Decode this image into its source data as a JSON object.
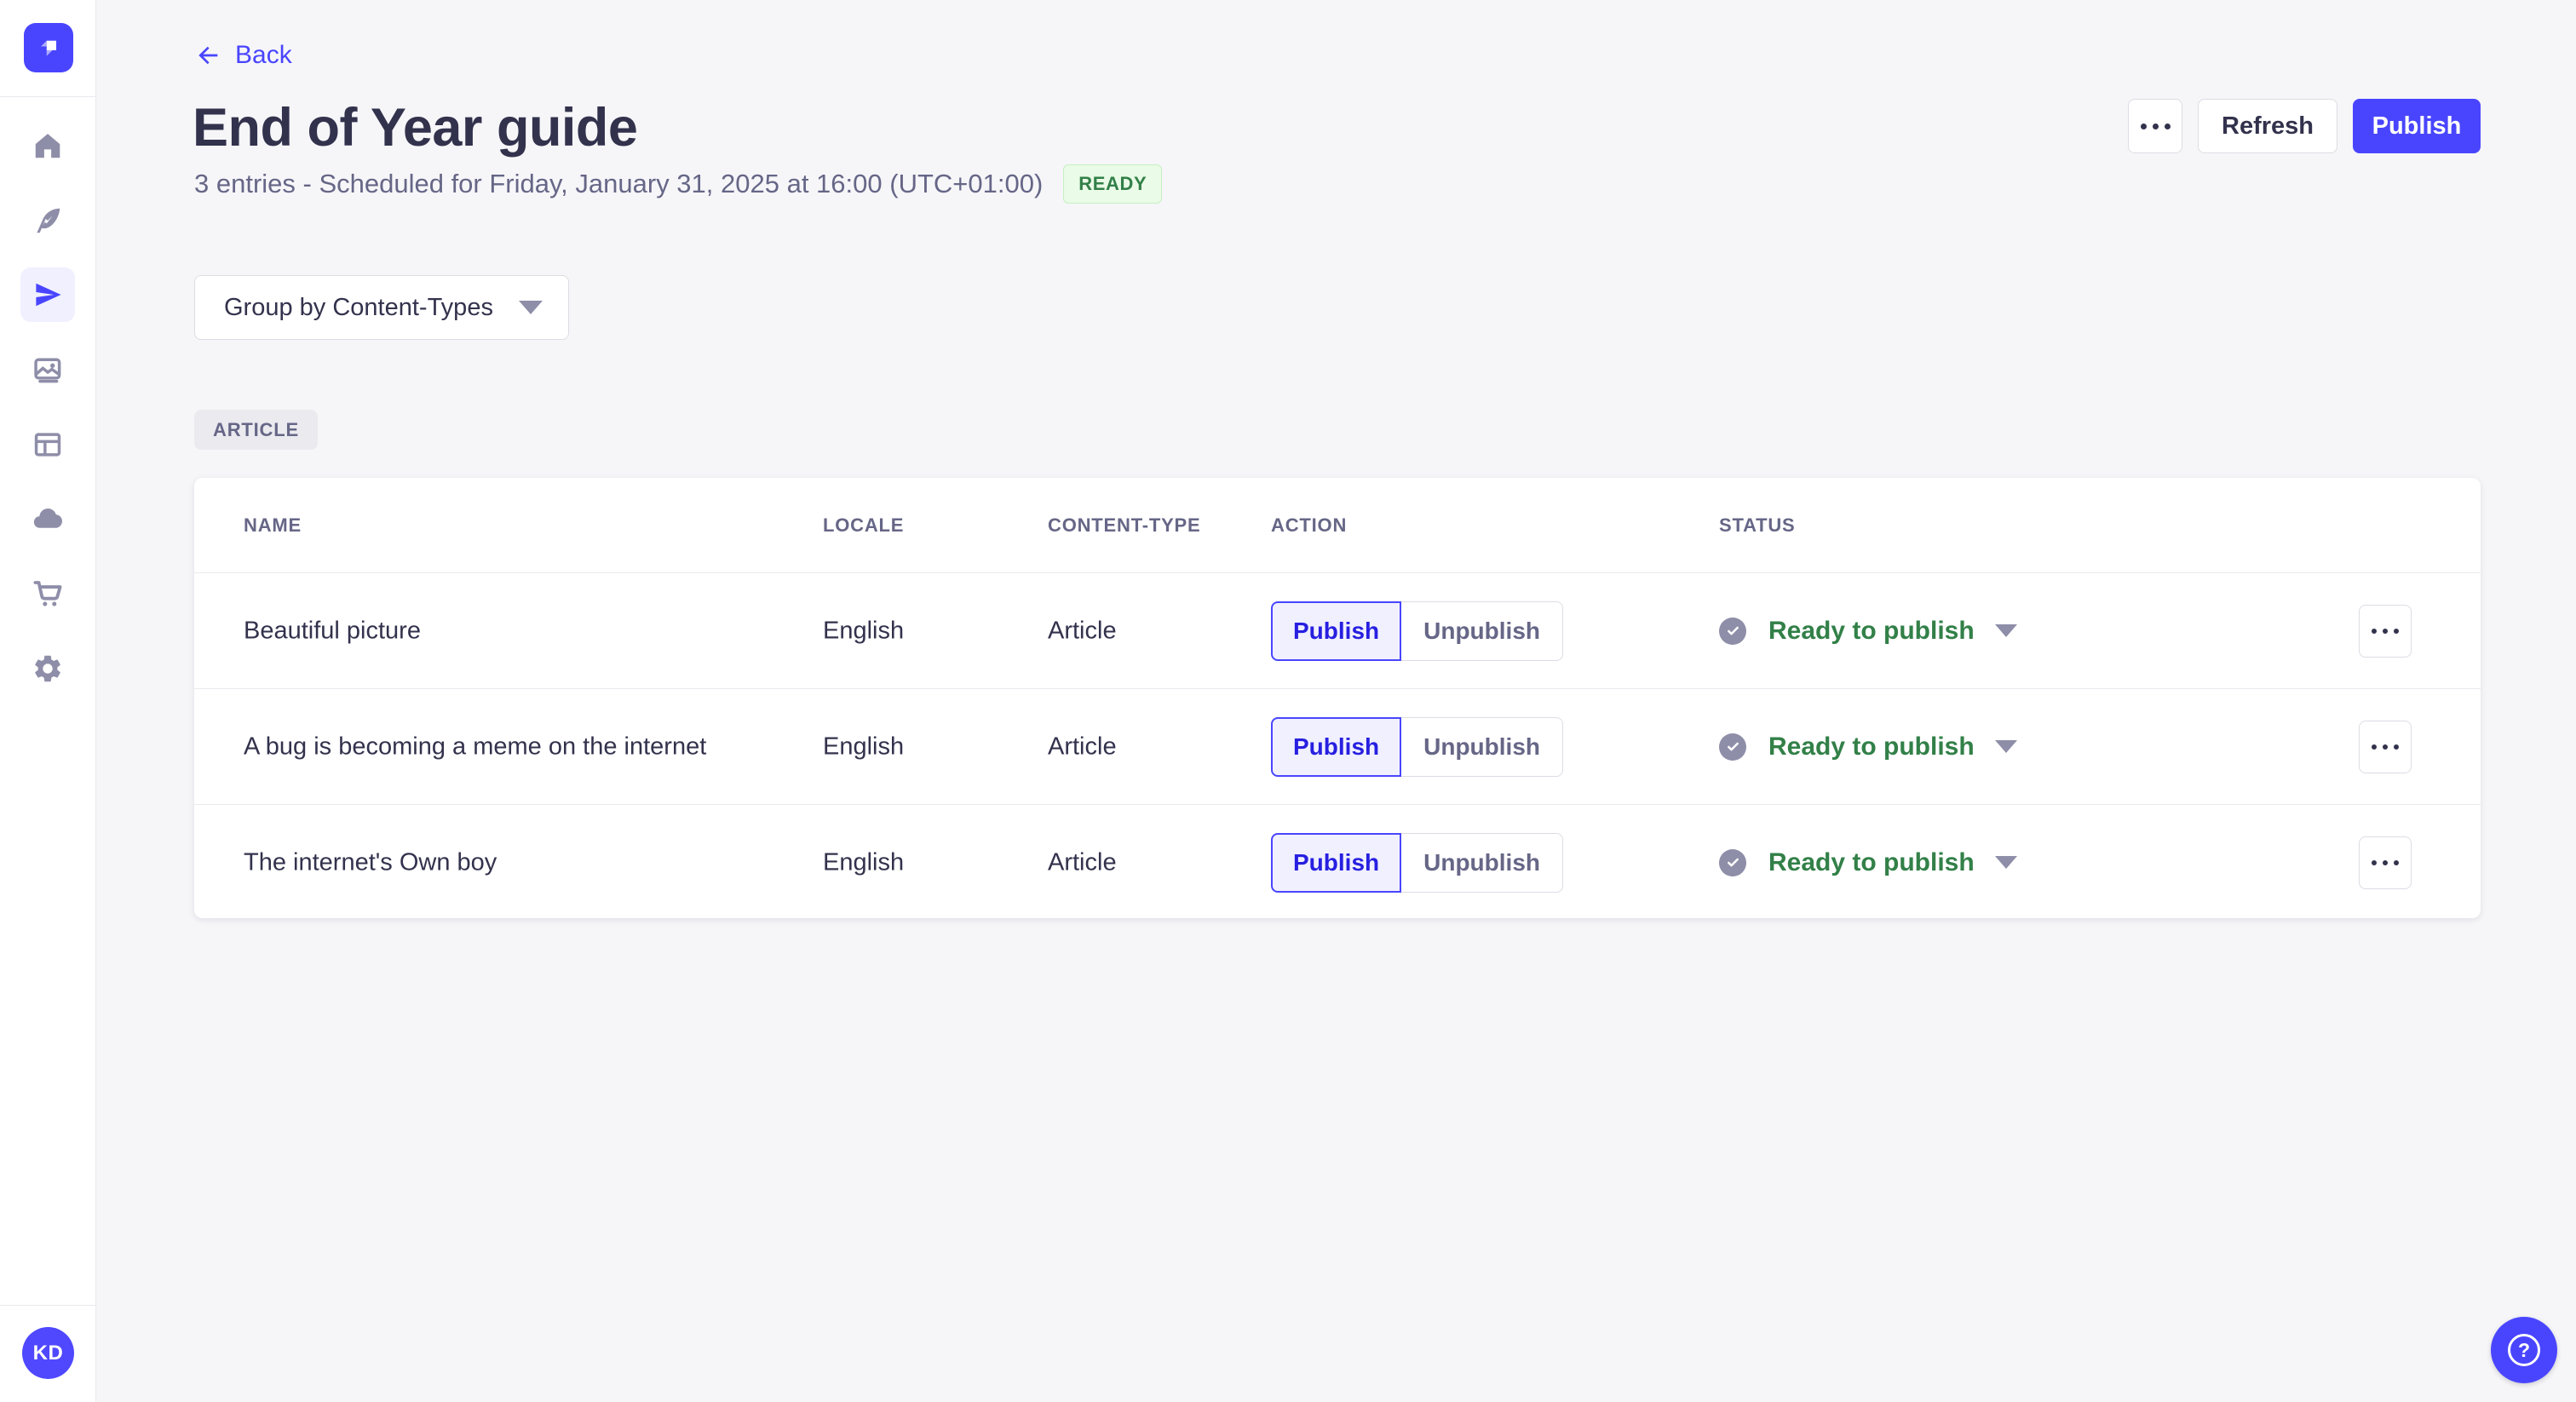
{
  "colors": {
    "accent": "#4945ff",
    "accent_light_bg": "#f0f0ff",
    "accent_dark_text": "#271fe0",
    "success_text": "#328048",
    "success_bg": "#eafbe7",
    "neutral_text": "#32324d",
    "muted_text": "#666687",
    "icon_gray": "#8e8ea9",
    "border": "#dcdce4",
    "page_bg": "#f6f6f9"
  },
  "sidebar": {
    "items": [
      {
        "icon": "house"
      },
      {
        "icon": "feather"
      },
      {
        "icon": "paper-plane",
        "active": true
      },
      {
        "icon": "pictures"
      },
      {
        "icon": "layout"
      },
      {
        "icon": "cloud"
      },
      {
        "icon": "shopping-cart"
      },
      {
        "icon": "gear"
      }
    ],
    "avatar_initials": "KD"
  },
  "header": {
    "back_label": "Back",
    "title": "End of Year guide",
    "subtitle": "3 entries - Scheduled for Friday, January 31, 2025 at 16:00 (UTC+01:00)",
    "status_badge": "READY",
    "refresh_label": "Refresh",
    "publish_label": "Publish"
  },
  "toolbar": {
    "group_by_label": "Group by Content-Types"
  },
  "group": {
    "badge": "ARTICLE"
  },
  "table": {
    "headers": [
      "NAME",
      "LOCALE",
      "CONTENT-TYPE",
      "ACTION",
      "STATUS"
    ],
    "action_publish": "Publish",
    "action_unpublish": "Unpublish",
    "rows": [
      {
        "name": "Beautiful picture",
        "locale": "English",
        "content_type": "Article",
        "status": "Ready to publish"
      },
      {
        "name": "A bug is becoming a meme on the internet",
        "locale": "English",
        "content_type": "Article",
        "status": "Ready to publish"
      },
      {
        "name": "The internet's Own boy",
        "locale": "English",
        "content_type": "Article",
        "status": "Ready to publish"
      }
    ]
  },
  "fab": {
    "icon_glyph": "?"
  }
}
